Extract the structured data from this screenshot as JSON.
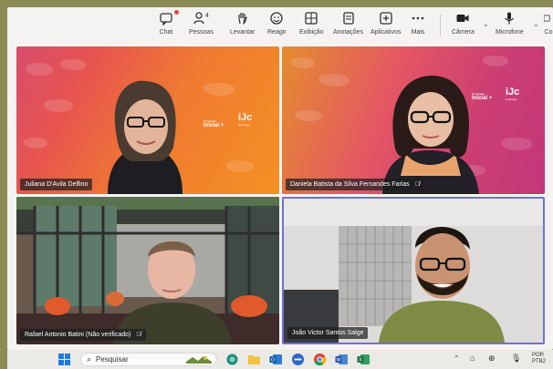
{
  "toolbar": {
    "chat": "Chat",
    "pessoas": "Pessoas",
    "pessoas_count": "4",
    "levantar": "Levantar",
    "reagir": "Reagir",
    "exibicao": "Exibição",
    "anotacoes": "Anotações",
    "aplicativos": "Aplicativos",
    "mais": "Mais",
    "camera": "Câmera",
    "microfone": "Microfone",
    "compartilhar": "Co"
  },
  "tiles": [
    {
      "name": "Juliana D'Avila Delfino",
      "muted": false
    },
    {
      "name": "Daniela Batista da Silva Fernandes Farias",
      "muted": true
    },
    {
      "name": "Rafael Antonio Batini (Não verificado)",
      "muted": true
    },
    {
      "name": "João Victor Santos Salge",
      "muted": false
    }
  ],
  "branding": {
    "small_text": "Programa",
    "inicial": "Inicial +",
    "logo": "iJc",
    "logo_sub": "& Amigos"
  },
  "taskbar": {
    "search_placeholder": "Pesquisar",
    "lang_line1": "POR",
    "lang_line2": "PTB2"
  },
  "colors": {
    "frame": "#8c8a55",
    "active_speaker_border": "#6d72d6",
    "chat_badge": "#e5463a"
  }
}
